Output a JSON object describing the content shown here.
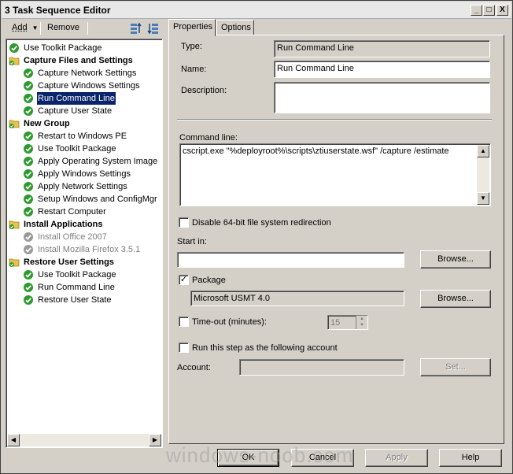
{
  "window": {
    "title": "3 Task Sequence Editor",
    "controls": {
      "minimize": "_",
      "maximize": "□",
      "close": "X"
    }
  },
  "toolbar": {
    "add_label": "Add",
    "remove_label": "Remove"
  },
  "tree": [
    {
      "label": "Use Toolkit Package",
      "type": "step",
      "level": 0,
      "status": "ok"
    },
    {
      "label": "Capture Files and Settings",
      "type": "group",
      "level": 0
    },
    {
      "label": "Capture Network Settings",
      "type": "step",
      "level": 1,
      "status": "ok"
    },
    {
      "label": "Capture Windows Settings",
      "type": "step",
      "level": 1,
      "status": "ok"
    },
    {
      "label": "Run Command Line",
      "type": "step",
      "level": 1,
      "status": "ok",
      "selected": true
    },
    {
      "label": "Capture User State",
      "type": "step",
      "level": 1,
      "status": "ok"
    },
    {
      "label": "New Group",
      "type": "group",
      "level": 0
    },
    {
      "label": "Restart to Windows PE",
      "type": "step",
      "level": 1,
      "status": "ok"
    },
    {
      "label": "Use Toolkit Package",
      "type": "step",
      "level": 1,
      "status": "ok"
    },
    {
      "label": "Apply Operating System Image",
      "type": "step",
      "level": 1,
      "status": "ok"
    },
    {
      "label": "Apply Windows Settings",
      "type": "step",
      "level": 1,
      "status": "ok"
    },
    {
      "label": "Apply Network Settings",
      "type": "step",
      "level": 1,
      "status": "ok"
    },
    {
      "label": "Setup Windows and ConfigMgr",
      "type": "step",
      "level": 1,
      "status": "ok"
    },
    {
      "label": "Restart Computer",
      "type": "step",
      "level": 1,
      "status": "ok"
    },
    {
      "label": "Install Applications",
      "type": "group",
      "level": 0
    },
    {
      "label": "Install Office 2007",
      "type": "step",
      "level": 1,
      "status": "disabled"
    },
    {
      "label": "Install Mozilla Firefox 3.5.1",
      "type": "step",
      "level": 1,
      "status": "disabled"
    },
    {
      "label": "Restore User Settings",
      "type": "group",
      "level": 0
    },
    {
      "label": "Use Toolkit Package",
      "type": "step",
      "level": 1,
      "status": "ok"
    },
    {
      "label": "Run Command Line",
      "type": "step",
      "level": 1,
      "status": "ok"
    },
    {
      "label": "Restore User State",
      "type": "step",
      "level": 1,
      "status": "ok"
    }
  ],
  "tabs": {
    "properties": "Properties",
    "options": "Options"
  },
  "props": {
    "type_label": "Type:",
    "type_value": "Run Command Line",
    "name_label": "Name:",
    "name_value": "Run Command Line",
    "description_label": "Description:",
    "description_value": "",
    "command_label": "Command line:",
    "command_value": "cscript.exe \"%deployroot%\\scripts\\ztiuserstate.wsf\" /capture /estimate",
    "disable64_label": "Disable 64-bit file system redirection",
    "startin_label": "Start in:",
    "startin_value": "",
    "browse1_label": "Browse...",
    "package_label": "Package",
    "package_checked": true,
    "package_value": "Microsoft USMT 4.0",
    "browse2_label": "Browse...",
    "timeout_label": "Time-out (minutes):",
    "timeout_value": "15",
    "runas_label": "Run this step as the following account",
    "account_label": "Account:",
    "account_value": "",
    "set_label": "Set..."
  },
  "footer": {
    "ok_label": "OK",
    "cancel_label": "Cancel",
    "apply_label": "Apply",
    "help_label": "Help"
  },
  "watermark": "windows-noob.com",
  "colors": {
    "selection": "#0a246a",
    "ok_icon": "#2e9a2e",
    "disabled_icon": "#9a9a9a",
    "folder": "#e8c24a"
  }
}
